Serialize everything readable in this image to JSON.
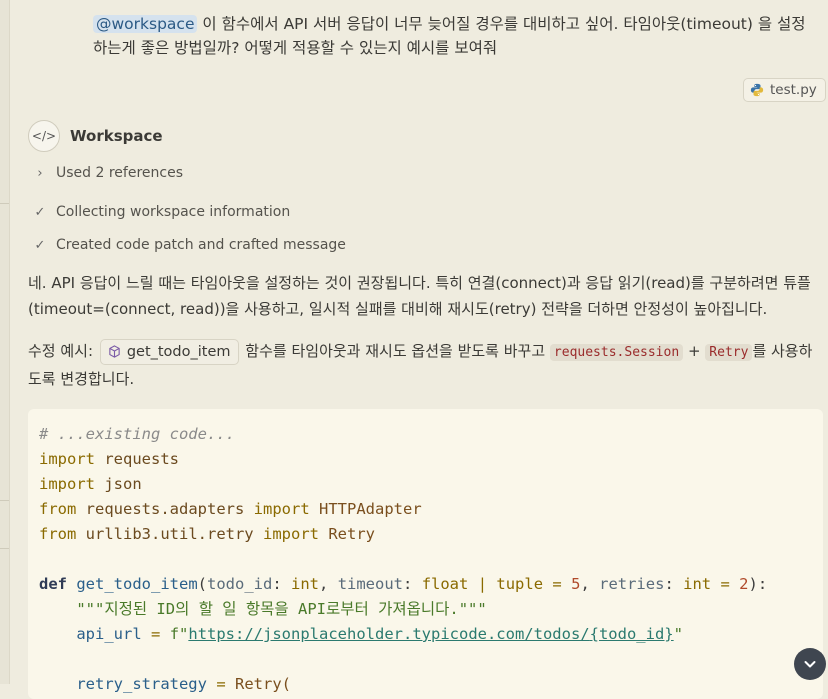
{
  "prompt": {
    "mention": "@workspace",
    "text": " 이 함수에서 API 서버 응답이 너무 늦어질 경우를 대비하고 싶어. 타임아웃(timeout) 을 설정하는게 좋은 방법일까? 어떻게 적용할 수 있는지 예시를 보여줘"
  },
  "file_chip": {
    "label": "test.py",
    "icon": "python-icon"
  },
  "workspace": {
    "title": "Workspace",
    "avatar": "</>"
  },
  "steps": [
    {
      "glyph": "›",
      "label": "Used 2 references"
    },
    {
      "glyph": "✓",
      "label": "Collecting workspace information"
    },
    {
      "glyph": "✓",
      "label": "Created code patch and crafted message"
    }
  ],
  "answer": {
    "p1": "네. API 응답이 느릴 때는 타임아웃을 설정하는 것이 권장됩니다. 특히 연결(connect)과 응답 읽기(read)를 구분하려면 튜플(timeout=(connect, read))을 사용하고, 일시적 실패를 대비해 재시도(retry) 전략을 더하면 안정성이 높아집니다.",
    "p2_prefix": "수정 예시:",
    "symbol": "get_todo_item",
    "p2_mid": "함수를 타임아웃과 재시도 옵션을 받도록 바꾸고",
    "code1": "requests.Session",
    "plus": "+",
    "code2": "Retry",
    "p2_suffix": "를 사용하도록 변경합니다."
  },
  "code": {
    "comment": "# ...existing code...",
    "l2_kw": "import",
    "l2_mod": "requests",
    "l3_kw": "import",
    "l3_mod": "json",
    "l4_kw1": "from",
    "l4_mod": "requests.adapters",
    "l4_kw2": "import",
    "l4_cls": "HTTPAdapter",
    "l5_kw1": "from",
    "l5_mod": "urllib3.util.retry",
    "l5_kw2": "import",
    "l5_cls": "Retry",
    "def_kw": "def",
    "fn_name": "get_todo_item",
    "p_id": "todo_id",
    "t_int": "int",
    "p_timeout": "timeout",
    "t_float": "float",
    "op_pipe": "|",
    "t_tuple": "tuple",
    "v_timeout": "5",
    "p_retries": "retries",
    "t_int2": "int",
    "v_retries": "2",
    "docstring": "\"\"\"지정된 ID의 할 일 항목을 API로부터 가져옵니다.\"\"\"",
    "var_url": "api_url",
    "f_prefix": "f\"",
    "url": "https://jsonplaceholder.typicode.com/todos/",
    "url_var": "{todo_id}",
    "l_retry_var": "retry_strategy",
    "l_retry_cls": "Retry("
  },
  "scroll_button": {
    "icon": "chevron-down-icon"
  }
}
